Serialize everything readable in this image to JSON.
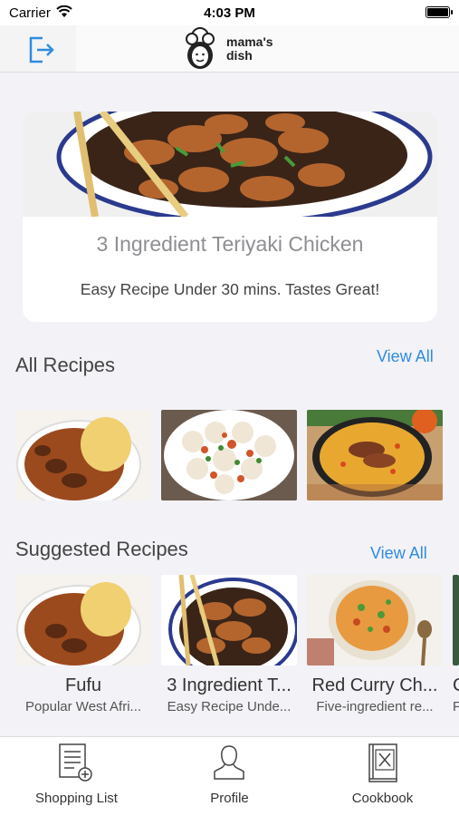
{
  "status_bar": {
    "carrier": "Carrier",
    "time": "4:03 PM"
  },
  "header": {
    "logout_icon": "logout-icon",
    "logo_icon": "chef-avatar-icon",
    "brand_line1": "mama's",
    "brand_line2": "dish"
  },
  "featured": {
    "title": "3 Ingredient Teriyaki Chicken",
    "subtitle": "Easy Recipe Under 30 mins. Tastes Great!"
  },
  "all_recipes": {
    "title": "All Recipes",
    "view_all": "View All"
  },
  "suggested": {
    "title": "Suggested Recipes",
    "view_all": "View All",
    "cards": [
      {
        "title": "Fufu",
        "subtitle": "Popular West Afri..."
      },
      {
        "title": "3 Ingredient T...",
        "subtitle": "Easy Recipe Unde..."
      },
      {
        "title": "Red Curry Ch...",
        "subtitle": "Five-ingredient re..."
      },
      {
        "title": "C",
        "subtitle": "F"
      }
    ]
  },
  "tabs": [
    {
      "label": "Shopping List",
      "icon": "shopping-list-icon"
    },
    {
      "label": "Profile",
      "icon": "profile-icon"
    },
    {
      "label": "Cookbook",
      "icon": "cookbook-icon"
    }
  ],
  "colors": {
    "accent": "#2f8ce0",
    "background": "#f2f2f7"
  }
}
